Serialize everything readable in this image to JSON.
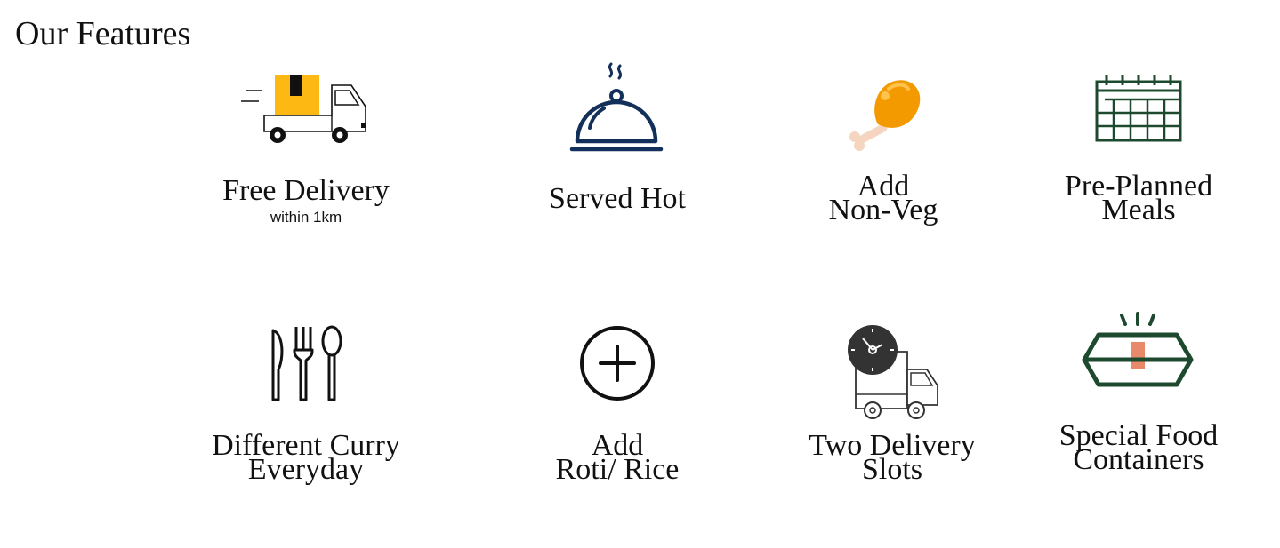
{
  "page": {
    "title": "Our Features"
  },
  "colors": {
    "box_yellow": "#fdb813",
    "navy": "#13305a",
    "chicken_orange": "#f29a00",
    "dark_green": "#1d4a2e",
    "container_orange": "#e8896a",
    "black": "#111111"
  },
  "features": [
    {
      "id": "free-delivery",
      "icon": "delivery-truck-icon",
      "line1": "Free Delivery",
      "sublabel": "within 1km"
    },
    {
      "id": "served-hot",
      "icon": "food-cloche-icon",
      "line1": "Served Hot"
    },
    {
      "id": "add-non-veg",
      "icon": "chicken-leg-icon",
      "line1": "Add",
      "line2": "Non-Veg"
    },
    {
      "id": "pre-planned-meals",
      "icon": "calendar-icon",
      "line1": "Pre-Planned",
      "line2": "Meals"
    },
    {
      "id": "different-curry",
      "icon": "cutlery-icon",
      "line1": "Different Curry",
      "line2": "Everyday"
    },
    {
      "id": "add-roti-rice",
      "icon": "plus-circle-icon",
      "line1": "Add",
      "line2": "Roti/ Rice"
    },
    {
      "id": "two-delivery-slots",
      "icon": "clock-truck-icon",
      "line1": "Two Delivery",
      "line2": "Slots"
    },
    {
      "id": "special-food-containers",
      "icon": "food-container-icon",
      "line1": "Special Food",
      "line2": "Containers"
    }
  ]
}
